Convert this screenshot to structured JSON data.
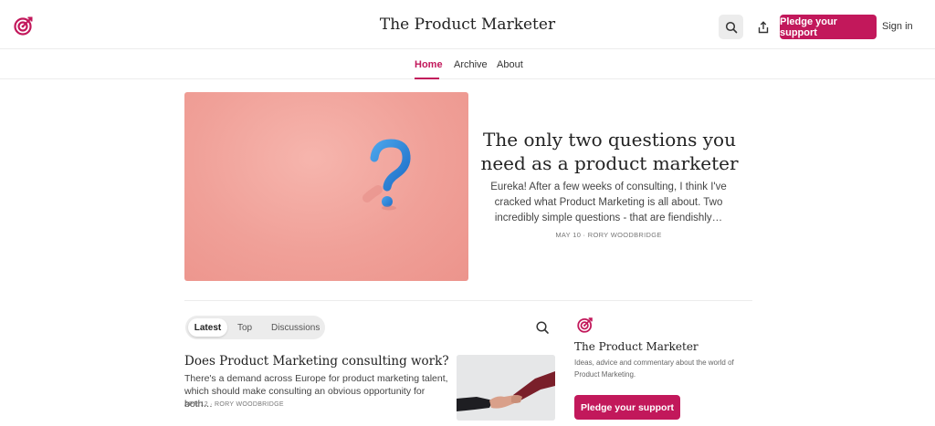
{
  "header": {
    "site_title": "The Product Marketer",
    "pledge_label": "Pledge your support",
    "signin_label": "Sign in",
    "brand_color": "#c2185b"
  },
  "nav": {
    "items": [
      {
        "label": "Home",
        "active": true
      },
      {
        "label": "Archive",
        "active": false
      },
      {
        "label": "About",
        "active": false
      }
    ]
  },
  "hero": {
    "title": "The only two questions you need as a product marketer",
    "excerpt": "Eureka! After a few weeks of consulting, I think I've cracked what Product Marketing is all about. Two incredibly simple questions - that are fiendishly…",
    "meta": "MAY 10 · RORY WOODBRIDGE"
  },
  "tabs": {
    "items": [
      "Latest",
      "Top",
      "Discussions"
    ],
    "active": "Latest"
  },
  "posts": [
    {
      "title": "Does Product Marketing consulting work?",
      "excerpt": "There's a demand across Europe for product marketing talent, which should make consulting an obvious opportunity for both…",
      "meta": "APR 12 · RORY WOODBRIDGE"
    }
  ],
  "sidebar": {
    "title": "The Product Marketer",
    "description": "Ideas, advice and commentary about the world of Product Marketing.",
    "pledge_label": "Pledge your support"
  },
  "icons": {
    "logo": "target-icon",
    "search": "search-icon",
    "share": "share-icon"
  }
}
